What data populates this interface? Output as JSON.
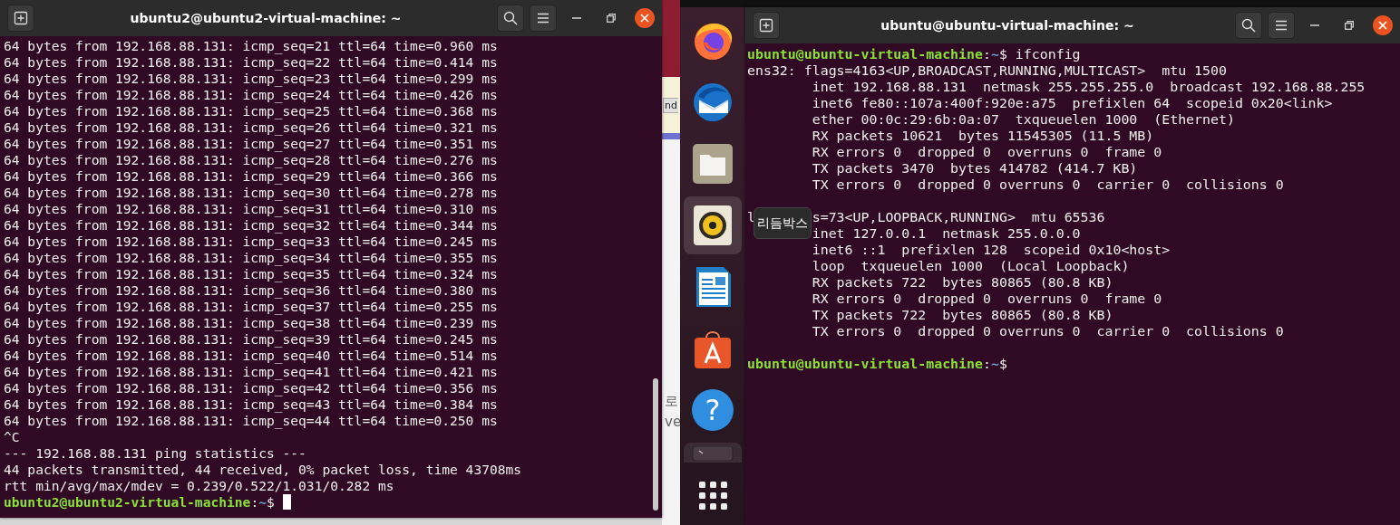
{
  "background_window": {
    "button": "nd",
    "texts": [
      "로",
      "ve"
    ]
  },
  "left_terminal": {
    "title": "ubuntu2@ubuntu2-virtual-machine: ~",
    "lines": [
      {
        "kind": "text",
        "text": "64 bytes from 192.168.88.131: icmp_seq=21 ttl=64 time=0.960 ms"
      },
      {
        "kind": "text",
        "text": "64 bytes from 192.168.88.131: icmp_seq=22 ttl=64 time=0.414 ms"
      },
      {
        "kind": "text",
        "text": "64 bytes from 192.168.88.131: icmp_seq=23 ttl=64 time=0.299 ms"
      },
      {
        "kind": "text",
        "text": "64 bytes from 192.168.88.131: icmp_seq=24 ttl=64 time=0.426 ms"
      },
      {
        "kind": "text",
        "text": "64 bytes from 192.168.88.131: icmp_seq=25 ttl=64 time=0.368 ms"
      },
      {
        "kind": "text",
        "text": "64 bytes from 192.168.88.131: icmp_seq=26 ttl=64 time=0.321 ms"
      },
      {
        "kind": "text",
        "text": "64 bytes from 192.168.88.131: icmp_seq=27 ttl=64 time=0.351 ms"
      },
      {
        "kind": "text",
        "text": "64 bytes from 192.168.88.131: icmp_seq=28 ttl=64 time=0.276 ms"
      },
      {
        "kind": "text",
        "text": "64 bytes from 192.168.88.131: icmp_seq=29 ttl=64 time=0.366 ms"
      },
      {
        "kind": "text",
        "text": "64 bytes from 192.168.88.131: icmp_seq=30 ttl=64 time=0.278 ms"
      },
      {
        "kind": "text",
        "text": "64 bytes from 192.168.88.131: icmp_seq=31 ttl=64 time=0.310 ms"
      },
      {
        "kind": "text",
        "text": "64 bytes from 192.168.88.131: icmp_seq=32 ttl=64 time=0.344 ms"
      },
      {
        "kind": "text",
        "text": "64 bytes from 192.168.88.131: icmp_seq=33 ttl=64 time=0.245 ms"
      },
      {
        "kind": "text",
        "text": "64 bytes from 192.168.88.131: icmp_seq=34 ttl=64 time=0.355 ms"
      },
      {
        "kind": "text",
        "text": "64 bytes from 192.168.88.131: icmp_seq=35 ttl=64 time=0.324 ms"
      },
      {
        "kind": "text",
        "text": "64 bytes from 192.168.88.131: icmp_seq=36 ttl=64 time=0.380 ms"
      },
      {
        "kind": "text",
        "text": "64 bytes from 192.168.88.131: icmp_seq=37 ttl=64 time=0.255 ms"
      },
      {
        "kind": "text",
        "text": "64 bytes from 192.168.88.131: icmp_seq=38 ttl=64 time=0.239 ms"
      },
      {
        "kind": "text",
        "text": "64 bytes from 192.168.88.131: icmp_seq=39 ttl=64 time=0.245 ms"
      },
      {
        "kind": "text",
        "text": "64 bytes from 192.168.88.131: icmp_seq=40 ttl=64 time=0.514 ms"
      },
      {
        "kind": "text",
        "text": "64 bytes from 192.168.88.131: icmp_seq=41 ttl=64 time=0.421 ms"
      },
      {
        "kind": "text",
        "text": "64 bytes from 192.168.88.131: icmp_seq=42 ttl=64 time=0.356 ms"
      },
      {
        "kind": "text",
        "text": "64 bytes from 192.168.88.131: icmp_seq=43 ttl=64 time=0.384 ms"
      },
      {
        "kind": "text",
        "text": "64 bytes from 192.168.88.131: icmp_seq=44 ttl=64 time=0.250 ms"
      },
      {
        "kind": "text",
        "text": "^C"
      },
      {
        "kind": "text",
        "text": "--- 192.168.88.131 ping statistics ---"
      },
      {
        "kind": "text",
        "text": "44 packets transmitted, 44 received, 0% packet loss, time 43708ms"
      },
      {
        "kind": "text",
        "text": "rtt min/avg/max/mdev = 0.239/0.522/1.031/0.282 ms"
      },
      {
        "kind": "prompt",
        "user_host": "ubuntu2@ubuntu2-virtual-machine",
        "colon": ":",
        "path": "~",
        "symbol": "$",
        "cursor": true
      }
    ]
  },
  "dock": {
    "items": [
      {
        "kind": "browser",
        "selected": false
      },
      {
        "kind": "mail",
        "selected": false
      },
      {
        "kind": "files",
        "selected": false
      },
      {
        "kind": "music",
        "selected": true
      },
      {
        "kind": "writer",
        "selected": false
      },
      {
        "kind": "store",
        "selected": false
      },
      {
        "kind": "help",
        "selected": false,
        "glyph": "?"
      },
      {
        "kind": "terminal",
        "selected": false
      },
      {
        "kind": "apps",
        "selected": false
      }
    ]
  },
  "tooltip": "리듬박스",
  "right_terminal": {
    "title": "ubuntu@ubuntu-virtual-machine: ~",
    "lines": [
      {
        "kind": "prompt",
        "user_host": "ubuntu@ubuntu-virtual-machine",
        "colon": ":",
        "path": "~",
        "symbol": "$",
        "command": "ifconfig"
      },
      {
        "kind": "text",
        "text": "ens32: flags=4163<UP,BROADCAST,RUNNING,MULTICAST>  mtu 1500"
      },
      {
        "kind": "text",
        "text": "        inet 192.168.88.131  netmask 255.255.255.0  broadcast 192.168.88.255"
      },
      {
        "kind": "text",
        "text": "        inet6 fe80::107a:400f:920e:a75  prefixlen 64  scopeid 0x20<link>"
      },
      {
        "kind": "text",
        "text": "        ether 00:0c:29:6b:0a:07  txqueuelen 1000  (Ethernet)"
      },
      {
        "kind": "text",
        "text": "        RX packets 10621  bytes 11545305 (11.5 MB)"
      },
      {
        "kind": "text",
        "text": "        RX errors 0  dropped 0  overruns 0  frame 0"
      },
      {
        "kind": "text",
        "text": "        TX packets 3470  bytes 414782 (414.7 KB)"
      },
      {
        "kind": "text",
        "text": "        TX errors 0  dropped 0 overruns 0  carrier 0  collisions 0"
      },
      {
        "kind": "blank"
      },
      {
        "kind": "split",
        "parts": [
          "l",
          "s=73<UP,LOOPBACK,RUNNING>  mtu 65536"
        ]
      },
      {
        "kind": "text",
        "text": "        inet 127.0.0.1  netmask 255.0.0.0"
      },
      {
        "kind": "text",
        "text": "        inet6 ::1  prefixlen 128  scopeid 0x10<host>"
      },
      {
        "kind": "text",
        "text": "        loop  txqueuelen 1000  (Local Loopback)"
      },
      {
        "kind": "text",
        "text": "        RX packets 722  bytes 80865 (80.8 KB)"
      },
      {
        "kind": "text",
        "text": "        RX errors 0  dropped 0  overruns 0  frame 0"
      },
      {
        "kind": "text",
        "text": "        TX packets 722  bytes 80865 (80.8 KB)"
      },
      {
        "kind": "text",
        "text": "        TX errors 0  dropped 0 overruns 0  carrier 0  collisions 0"
      },
      {
        "kind": "blank"
      },
      {
        "kind": "prompt",
        "user_host": "ubuntu@ubuntu-virtual-machine",
        "colon": ":",
        "path": "~",
        "symbol": "$"
      }
    ]
  }
}
